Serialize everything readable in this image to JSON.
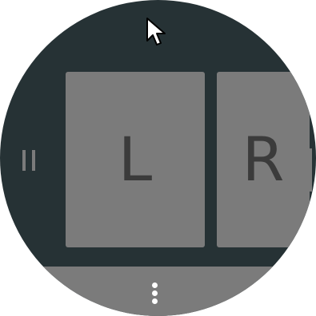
{
  "keys": [
    {
      "label": "L"
    },
    {
      "label": "R"
    }
  ],
  "icons": {
    "cursor": "mouse-cursor-icon",
    "pause": "pause-icon",
    "menu": "more-vertical-icon"
  },
  "colors": {
    "background": "#263235",
    "key_fill": "#7b7b7b",
    "key_text": "#3b3b3b",
    "dots": "#ffffff"
  }
}
